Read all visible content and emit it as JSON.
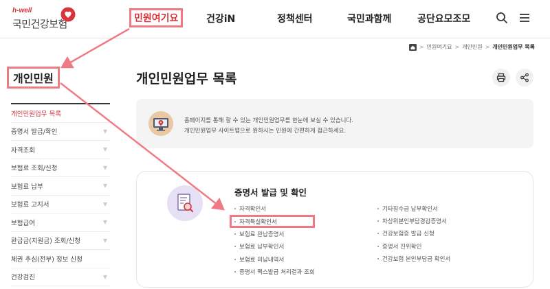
{
  "header": {
    "logo_small": "h-well",
    "logo_main": "국민건강보험",
    "nav": [
      "민원여기요",
      "건강iN",
      "정책센터",
      "국민과함께",
      "공단요모조모"
    ],
    "active_nav_index": 0
  },
  "breadcrumb": [
    "민원여기요",
    "개인민원",
    "개인민원업무 목록"
  ],
  "sidebar": {
    "title": "개인민원",
    "items": [
      {
        "label": "개인민원업무 목록",
        "active": true,
        "chevron": false
      },
      {
        "label": "증명서 발급/확인",
        "active": false,
        "chevron": true
      },
      {
        "label": "자격조회",
        "active": false,
        "chevron": true
      },
      {
        "label": "보험료 조회/신청",
        "active": false,
        "chevron": true
      },
      {
        "label": "보험료 납부",
        "active": false,
        "chevron": true
      },
      {
        "label": "보험료 고지서",
        "active": false,
        "chevron": true
      },
      {
        "label": "보험급여",
        "active": false,
        "chevron": true
      },
      {
        "label": "환급금(지원금) 조회/신청",
        "active": false,
        "chevron": true
      },
      {
        "label": "체권 추심(전부) 정보 신청",
        "active": false,
        "chevron": false
      },
      {
        "label": "건강검진",
        "active": false,
        "chevron": true
      }
    ]
  },
  "main": {
    "title": "개인민원업무 목록",
    "info_line1": "홈페이지를 통해 할 수 있는 개인민원업무를 한눈에 보실 수 있습니다.",
    "info_line2": "개인민원업무 사이트맵으로 원하시는 민원에 간편하게 접근하세요.",
    "section": {
      "title": "증명서 발급 및 확인",
      "left_items": [
        "자격확인서",
        "자격득실확인서",
        "보험료 완납증명서",
        "보험료 납부확인서",
        "보험료 미납내역서",
        "증명서 팩스발급 처리결과 조회"
      ],
      "right_items": [
        "기타징수금 납부확인서",
        "차상위본인부담경감증명서",
        "건강보험증 발급 신청",
        "증명서 진위확인",
        "건강보험 본인부담금 확인서"
      ],
      "highlighted_left_index": 1
    }
  },
  "colors": {
    "accent": "#d8343b",
    "highlight": "#f07a84"
  },
  "icons": [
    "search-icon",
    "menu-icon",
    "home-icon",
    "print-icon",
    "share-icon",
    "monitor-pin-icon",
    "document-search-icon"
  ]
}
